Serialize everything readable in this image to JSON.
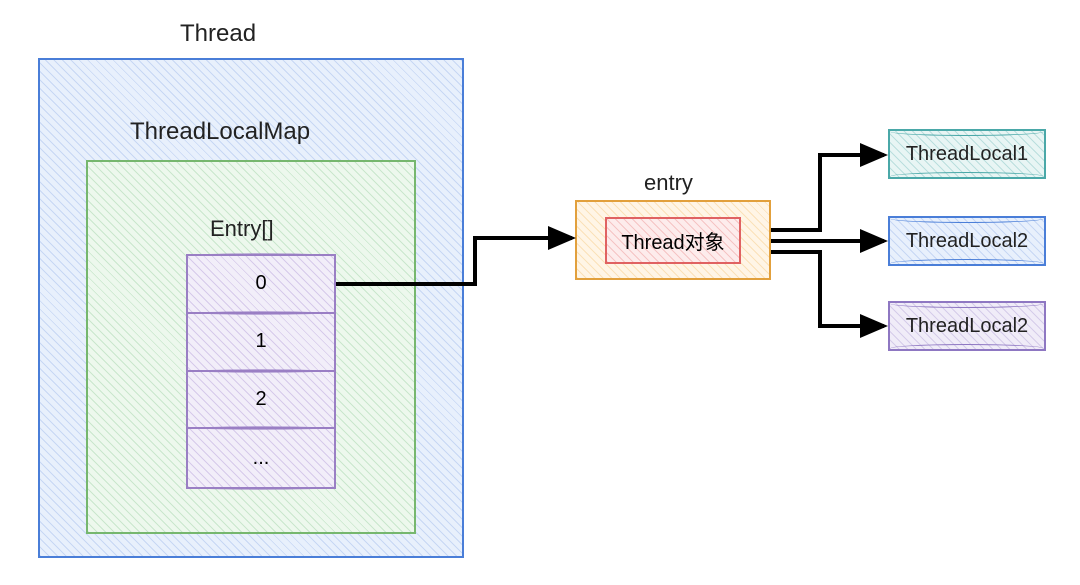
{
  "thread": {
    "title": "Thread"
  },
  "threadLocalMap": {
    "title": "ThreadLocalMap"
  },
  "entryArray": {
    "title": "Entry[]",
    "cells": {
      "c0": "0",
      "c1": "1",
      "c2": "2",
      "c3": "..."
    }
  },
  "entry": {
    "title": "entry",
    "threadObj": "Thread对象"
  },
  "threadLocals": {
    "tl1": "ThreadLocal1",
    "tl2": "ThreadLocal2",
    "tl3": "ThreadLocal2"
  }
}
